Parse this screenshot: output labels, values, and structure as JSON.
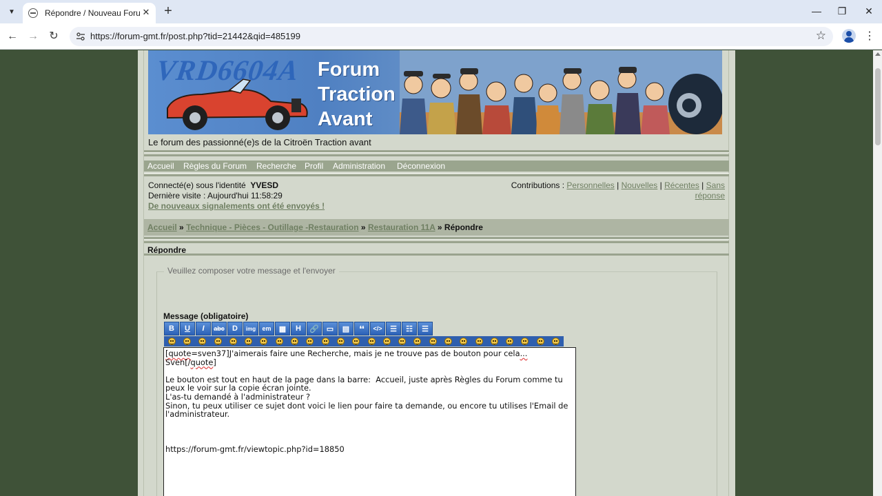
{
  "browser": {
    "tab_title": "Répondre / Nouveau Forum GMT",
    "url": "https://forum-gmt.fr/post.php?tid=21442&qid=485199",
    "new_tab_label": "+",
    "close_tab_label": "✕",
    "window_minimize": "—",
    "window_maximize": "❐",
    "window_close": "✕"
  },
  "header": {
    "banner_logo": "VRD6604A",
    "banner_title_line1": "Forum",
    "banner_title_line2": "Traction",
    "banner_title_line3": "Avant",
    "tagline": "Le forum des passionné(e)s de la Citroën Traction avant"
  },
  "menu": {
    "items": [
      "Accueil",
      "Règles du Forum",
      "Recherche",
      "Profil",
      "Administration",
      "Déconnexion"
    ]
  },
  "status": {
    "identity_label": "Connecté(e) sous l'identité",
    "username": "YVESD",
    "last_visit": "Dernière visite : Aujourd'hui 11:58:29",
    "alert_link": "De nouveaux signalements ont été envoyés !",
    "contrib_label": "Contributions :",
    "contrib_personal": "Personnelles",
    "contrib_new": "Nouvelles",
    "contrib_recent": "Récentes",
    "contrib_no_reply_1": "Sans",
    "contrib_no_reply_2": "réponse",
    "sep": "|"
  },
  "breadcrumb": {
    "home": "Accueil",
    "forum": "Technique - Pièces - Outillage -Restauration",
    "topic": "Restauration 11A",
    "current": "Répondre",
    "sep": "»"
  },
  "form": {
    "section_title": "Répondre",
    "legend": "Veuillez composer votre message et l'envoyer",
    "message_label": "Message (obligatoire)",
    "format_buttons": [
      "B",
      "U",
      "I",
      "abc",
      "D",
      "img",
      "em",
      "▦",
      "H",
      "🔗",
      "▭",
      "▤",
      "❛❛",
      "</>",
      "☰",
      "☷",
      "☰"
    ],
    "smiley_count": 26,
    "message_line1_a": "[quote",
    "message_line1_b": "=sven37]J'aimerais faire une Recherche, mais je ne trouve pas de bouton pour cela",
    "message_line1_c": "...",
    "message_line2_a": "Sven[/",
    "message_line2_b": "quote",
    "message_line2_c": "]",
    "message_body": "\n\nLe bouton est tout en haut de la page dans la barre:  Accueil, juste après Règles du Forum comme tu peux le voir sur la copie écran jointe.\nL'as-tu demandé à l'administrateur ?\nSinon, tu peux utiliser ce sujet dont voici le lien pour faire ta demande, ou encore tu utilises l'Email de l'administrateur.\n\n\n\nhttps://forum-gmt.fr/viewtopic.php?id=18850"
  },
  "colors": {
    "page_bg": "#3f5238",
    "content_bg": "#d3d8cc",
    "menu_bg": "#9aa58e",
    "link": "#6f7f62",
    "toolbar_button": "#2c62b7"
  }
}
